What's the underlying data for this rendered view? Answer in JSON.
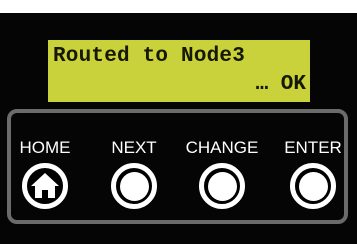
{
  "display": {
    "line1": "Routed to Node3",
    "line2": "… OK"
  },
  "buttons": [
    {
      "label": "HOME",
      "icon": "home-icon"
    },
    {
      "label": "NEXT",
      "icon": "dot-icon"
    },
    {
      "label": "CHANGE",
      "icon": "dot-icon"
    },
    {
      "label": "ENTER",
      "icon": "dot-icon"
    }
  ],
  "colors": {
    "lcd_background": "#c9d23a",
    "lcd_text": "#161800",
    "device_background": "#050505",
    "panel_border": "#6b6b6b",
    "button_foreground": "#ffffff"
  }
}
